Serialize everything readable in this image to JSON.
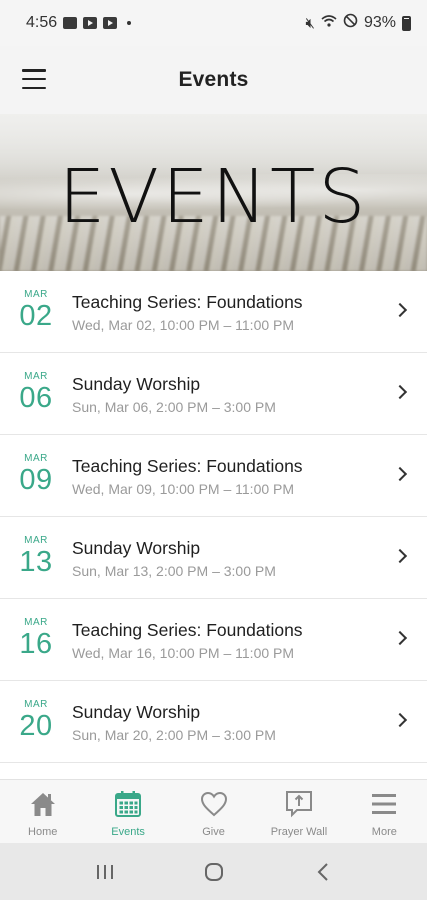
{
  "status_bar": {
    "time": "4:56",
    "battery": "93%"
  },
  "header": {
    "title": "Events"
  },
  "banner": {
    "text": "EVENTS"
  },
  "events": [
    {
      "month": "MAR",
      "day": "02",
      "title": "Teaching Series: Foundations",
      "time": "Wed, Mar 02, 10:00 PM – 11:00 PM"
    },
    {
      "month": "MAR",
      "day": "06",
      "title": "Sunday Worship",
      "time": "Sun, Mar 06, 2:00 PM – 3:00 PM"
    },
    {
      "month": "MAR",
      "day": "09",
      "title": "Teaching Series: Foundations",
      "time": "Wed, Mar 09, 10:00 PM – 11:00 PM"
    },
    {
      "month": "MAR",
      "day": "13",
      "title": "Sunday Worship",
      "time": "Sun, Mar 13, 2:00 PM – 3:00 PM"
    },
    {
      "month": "MAR",
      "day": "16",
      "title": "Teaching Series: Foundations",
      "time": "Wed, Mar 16, 10:00 PM – 11:00 PM"
    },
    {
      "month": "MAR",
      "day": "20",
      "title": "Sunday Worship",
      "time": "Sun, Mar 20, 2:00 PM – 3:00 PM"
    }
  ],
  "bottom_nav": {
    "active": "Events",
    "items": [
      {
        "label": "Home",
        "icon": "home-icon"
      },
      {
        "label": "Events",
        "icon": "calendar-icon"
      },
      {
        "label": "Give",
        "icon": "heart-icon"
      },
      {
        "label": "Prayer Wall",
        "icon": "prayer-wall-icon"
      },
      {
        "label": "More",
        "icon": "more-menu-icon"
      }
    ]
  },
  "colors": {
    "accent": "#3aa889",
    "inactive": "#8a8a8a",
    "header_bg": "#f4f4f4"
  }
}
